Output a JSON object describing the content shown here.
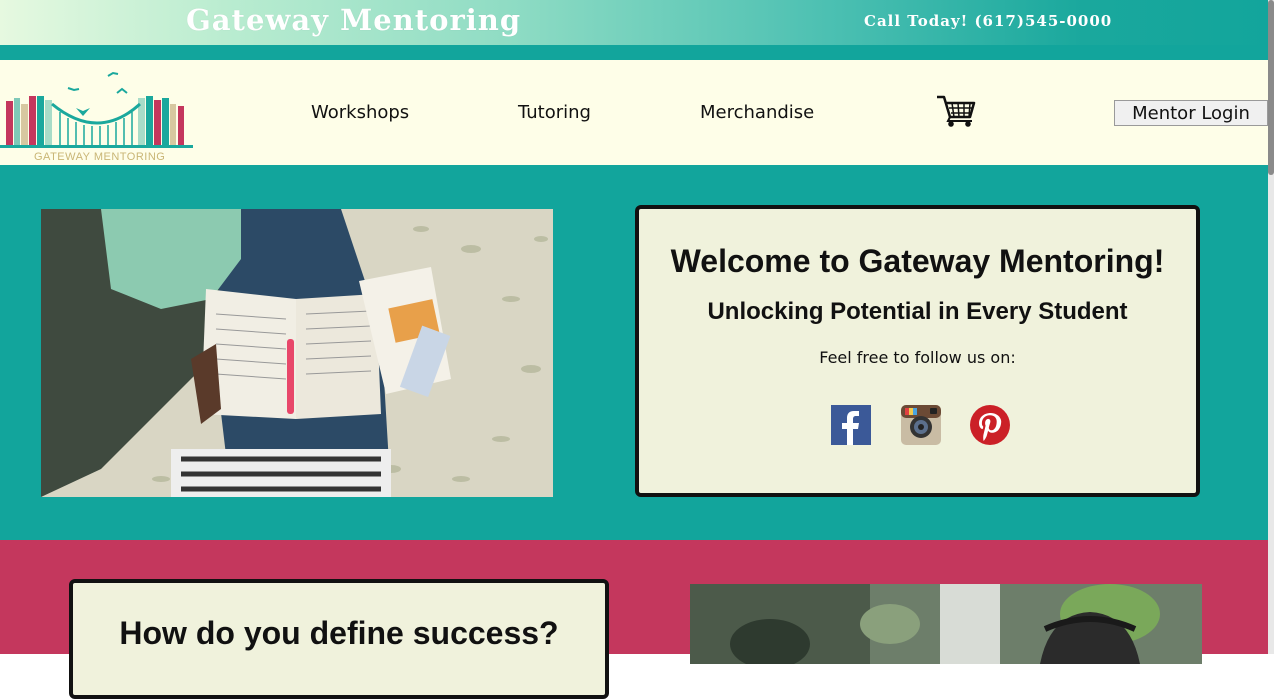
{
  "header": {
    "site_title": "Gateway Mentoring",
    "call_today": "Call Today! (617)545-0000"
  },
  "nav": {
    "logo_text": "GATEWAY MENTORING",
    "links": [
      "Workshops",
      "Tutoring",
      "Merchandise"
    ],
    "cart_icon": "shopping-cart-icon",
    "login_label": "Mentor Login"
  },
  "hero": {
    "title": "Welcome to Gateway Mentoring!",
    "subtitle": "Unlocking Potential in Every Student",
    "follow_text": "Feel free to follow us on:",
    "socials": [
      "facebook-icon",
      "instagram-icon",
      "pinterest-icon"
    ]
  },
  "section2": {
    "title": "How do you define success?"
  },
  "colors": {
    "teal": "#12a59c",
    "rose": "#c4375d",
    "cream": "#fefee8",
    "card": "#f0f2dc"
  }
}
